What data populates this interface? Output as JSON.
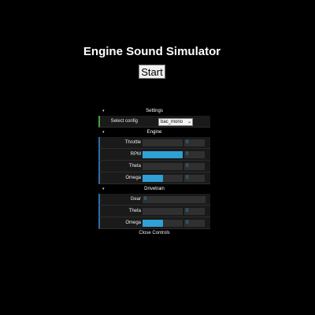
{
  "page": {
    "title": "Engine Sound Simulator",
    "start_label": "Start"
  },
  "gui": {
    "settings": {
      "title": "Settings",
      "select_label": "Select config",
      "select_value": "bac_mono"
    },
    "engine": {
      "title": "Engine",
      "rows": [
        {
          "label": "Throttle",
          "value": "0",
          "level": 0.0
        },
        {
          "label": "RPM",
          "value": "0",
          "level": 1.0
        },
        {
          "label": "Theta",
          "value": "0",
          "level": 0.0
        },
        {
          "label": "Omega",
          "value": "0",
          "level": 0.5
        }
      ]
    },
    "drivetrain": {
      "title": "Drivetrain",
      "gear": {
        "label": "Gear",
        "value": "0"
      },
      "rows": [
        {
          "label": "Theta",
          "value": "0",
          "level": 0.0
        },
        {
          "label": "Omega",
          "value": "0",
          "level": 0.5
        }
      ]
    },
    "close_label": "Close Controls",
    "colors": {
      "slider_fill": "#2fa1d6",
      "select_accent": "#4a9c44",
      "number_accent": "#2a6fa8"
    }
  }
}
